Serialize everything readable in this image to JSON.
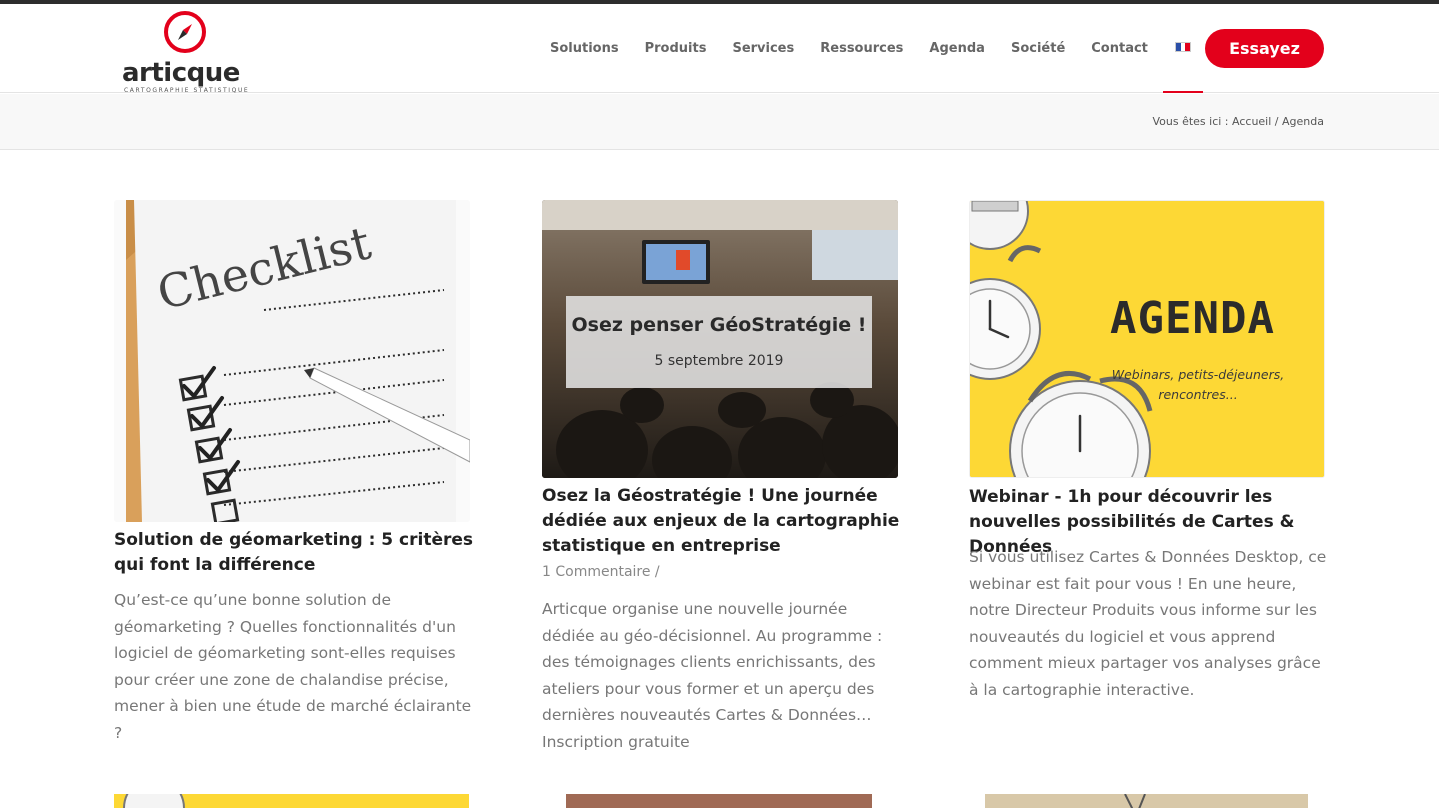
{
  "brand": {
    "name": "articque",
    "tagline": "CARTOGRAPHIE STATISTIQUE",
    "colors": {
      "accent": "#e3001b",
      "nav_text": "#666666",
      "dark": "#2d2d2d"
    }
  },
  "nav": {
    "items": [
      {
        "label": "Solutions"
      },
      {
        "label": "Produits"
      },
      {
        "label": "Services"
      },
      {
        "label": "Ressources"
      },
      {
        "label": "Agenda"
      },
      {
        "label": "Société"
      },
      {
        "label": "Contact"
      }
    ],
    "language_icon": "french-flag-icon",
    "search_icon": "search-icon",
    "cta_label": "Essayez"
  },
  "breadcrumb": {
    "prefix": "Vous êtes ici :",
    "home": "Accueil",
    "separator": "/",
    "current": "Agenda"
  },
  "posts": [
    {
      "image": {
        "kind": "checklist-photo",
        "text": "Checklist"
      },
      "title": "Solution de géomarketing : 5 critères qui font la différence",
      "meta": "",
      "excerpt": "Qu’est-ce qu’une bonne solution de géomarketing ? Quelles fonctionnalités d'un logiciel de géomarketing sont-elles requises pour créer une zone de chalandise précise, mener à bien une étude de marché éclairante ?"
    },
    {
      "image": {
        "kind": "conference-photo",
        "headline": "Osez penser GéoStratégie !",
        "date": "5 septembre 2019"
      },
      "title": "Osez la Géostratégie ! Une journée dédiée aux enjeux de la cartographie statistique en entreprise",
      "meta": "1 Commentaire /",
      "excerpt": "Articque organise une nouvelle journée dédiée au géo-décisionnel. Au programme : des témoignages clients enrichissants, des ateliers pour vous former et un aperçu des dernières nouveautés Cartes & Données… Inscription gratuite"
    },
    {
      "image": {
        "kind": "agenda-banner",
        "headline": "AGENDA",
        "subline": "Webinars, petits-déjeuners, rencontres..."
      },
      "title": "Webinar - 1h pour découvrir les nouvelles possibilités de Cartes & Données",
      "meta": "",
      "excerpt": "Si vous utilisez Cartes & Données Desktop, ce webinar est fait pour vous ! En une heure, notre Directeur Produits vous informe sur les nouveautés du logiciel et vous apprend comment mieux partager vos analyses grâce à la cartographie interactive."
    }
  ]
}
